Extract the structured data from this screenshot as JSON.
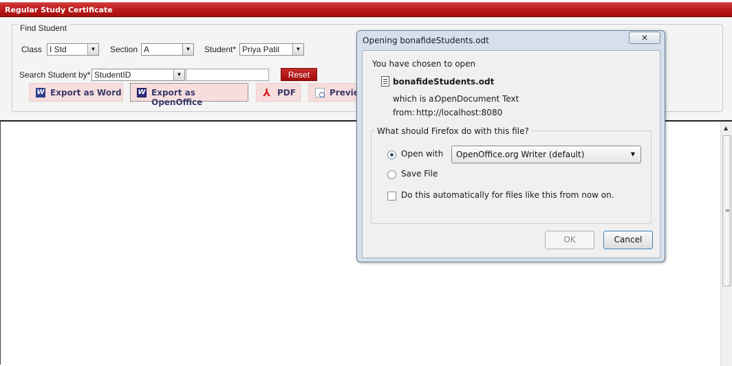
{
  "app": {
    "title": "Regular Study Certificate"
  },
  "find_student": {
    "legend": "Find Student",
    "class_label": "Class",
    "class_value": "I Std",
    "section_label": "Section",
    "section_value": "A",
    "student_label": "Student*",
    "student_value": "Priya Patil",
    "search_label": "Search Student by*",
    "search_by_value": "StudentID",
    "search_text_value": "",
    "reset_label": "Reset"
  },
  "export_buttons": [
    {
      "label": "Export as Word",
      "icon": "word-icon"
    },
    {
      "label": "Export as OpenOffice",
      "icon": "openoffice-icon"
    },
    {
      "label": "PDF",
      "icon": "pdf-icon"
    },
    {
      "label": "Preview",
      "icon": "preview-icon"
    }
  ],
  "dialog": {
    "title": "Opening bonafideStudents.odt",
    "close_label": "✕",
    "intro": "You have chosen to open",
    "filename": "bonafideStudents.odt",
    "which_is_label": "which is a:",
    "which_is_value": "OpenDocument Text",
    "from_label": "from:",
    "from_value": "http://localhost:8080",
    "question": "What should Firefox do with this file?",
    "open_with_label": "Open with",
    "open_with_app": "OpenOffice.org Writer (default)",
    "save_file_label": "Save File",
    "auto_label": "Do this automatically for files like this from now on.",
    "ok_label": "OK",
    "cancel_label": "Cancel",
    "selected_option": "open_with",
    "auto_checked": false
  },
  "colors": {
    "title_bar": "#b81818",
    "reset_button": "#b71919",
    "export_button_bg": "#f7dede",
    "dialog_frame": "#d6e0ed"
  }
}
